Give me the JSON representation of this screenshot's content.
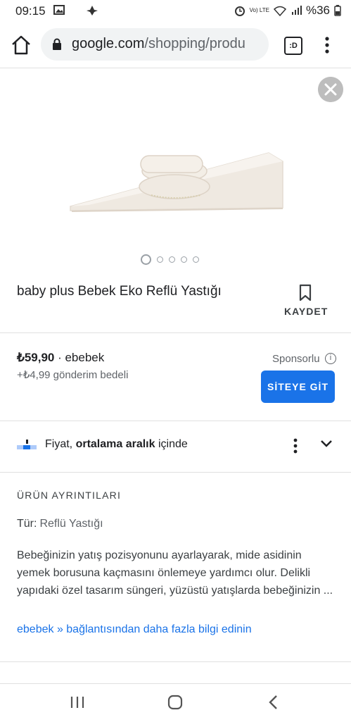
{
  "status": {
    "time": "09:15",
    "battery": "%36",
    "net": "Vo) LTE"
  },
  "browser": {
    "url_main": "google.com",
    "url_rest": "/shopping/produ",
    "tabs_label": ":D"
  },
  "product": {
    "title": "baby plus Bebek Eko Reflü Yastığı",
    "save_label": "KAYDET",
    "price": "₺59,90",
    "seller": "· ebebek",
    "shipping": "+₺4,99 gönderim bedeli",
    "sponsored": "Sponsorlu",
    "site_button": "SİTEYE GİT"
  },
  "price_insight": {
    "prefix": "Fiyat, ",
    "bold": "ortalama aralık",
    "suffix": " içinde"
  },
  "details": {
    "heading": "ÜRÜN AYRINTILARI",
    "type_label": "Tür:",
    "type_value": "Reflü Yastığı",
    "description": "Bebeğinizin yatış pozisyonunu ayarlayarak, mide asidinin yemek borusuna kaçmasını önlemeye yardımcı olur. Delikli yapıdaki özel tasarım süngeri, yüzüstü yatışlarda bebeğinizin ...",
    "more_link": "ebebek » bağlantısından daha fazla bilgi edinin"
  },
  "carousel": {
    "count": 5,
    "active": 0
  },
  "colors": {
    "accent": "#1a73e8"
  }
}
